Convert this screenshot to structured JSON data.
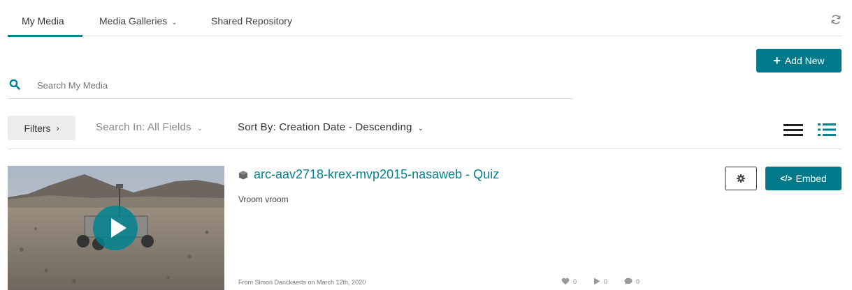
{
  "tabs": [
    {
      "label": "My Media",
      "active": true
    },
    {
      "label": "Media Galleries",
      "has_dropdown": true
    },
    {
      "label": "Shared Repository"
    }
  ],
  "toolbar": {
    "refresh_icon": "refresh-icon",
    "add_new_label": "Add New"
  },
  "search": {
    "placeholder": "Search My Media",
    "value": ""
  },
  "filter_bar": {
    "filters_label": "Filters",
    "search_in_label": "Search In: All Fields",
    "sort_by_label": "Sort By: Creation Date - Descending",
    "views": [
      "list-view-icon",
      "detailed-view-icon"
    ]
  },
  "entries": [
    {
      "title": "arc-aav2718-krex-mvp2015-nasaweb - Quiz",
      "description": "Vroom vroom",
      "meta": "From Simon Danckaerts on March 12th, 2020",
      "likes": "0",
      "plays": "0",
      "comments": "0",
      "embed_label": "Embed"
    }
  ],
  "colors": {
    "accent": "#00838f",
    "button": "#007a8a"
  }
}
